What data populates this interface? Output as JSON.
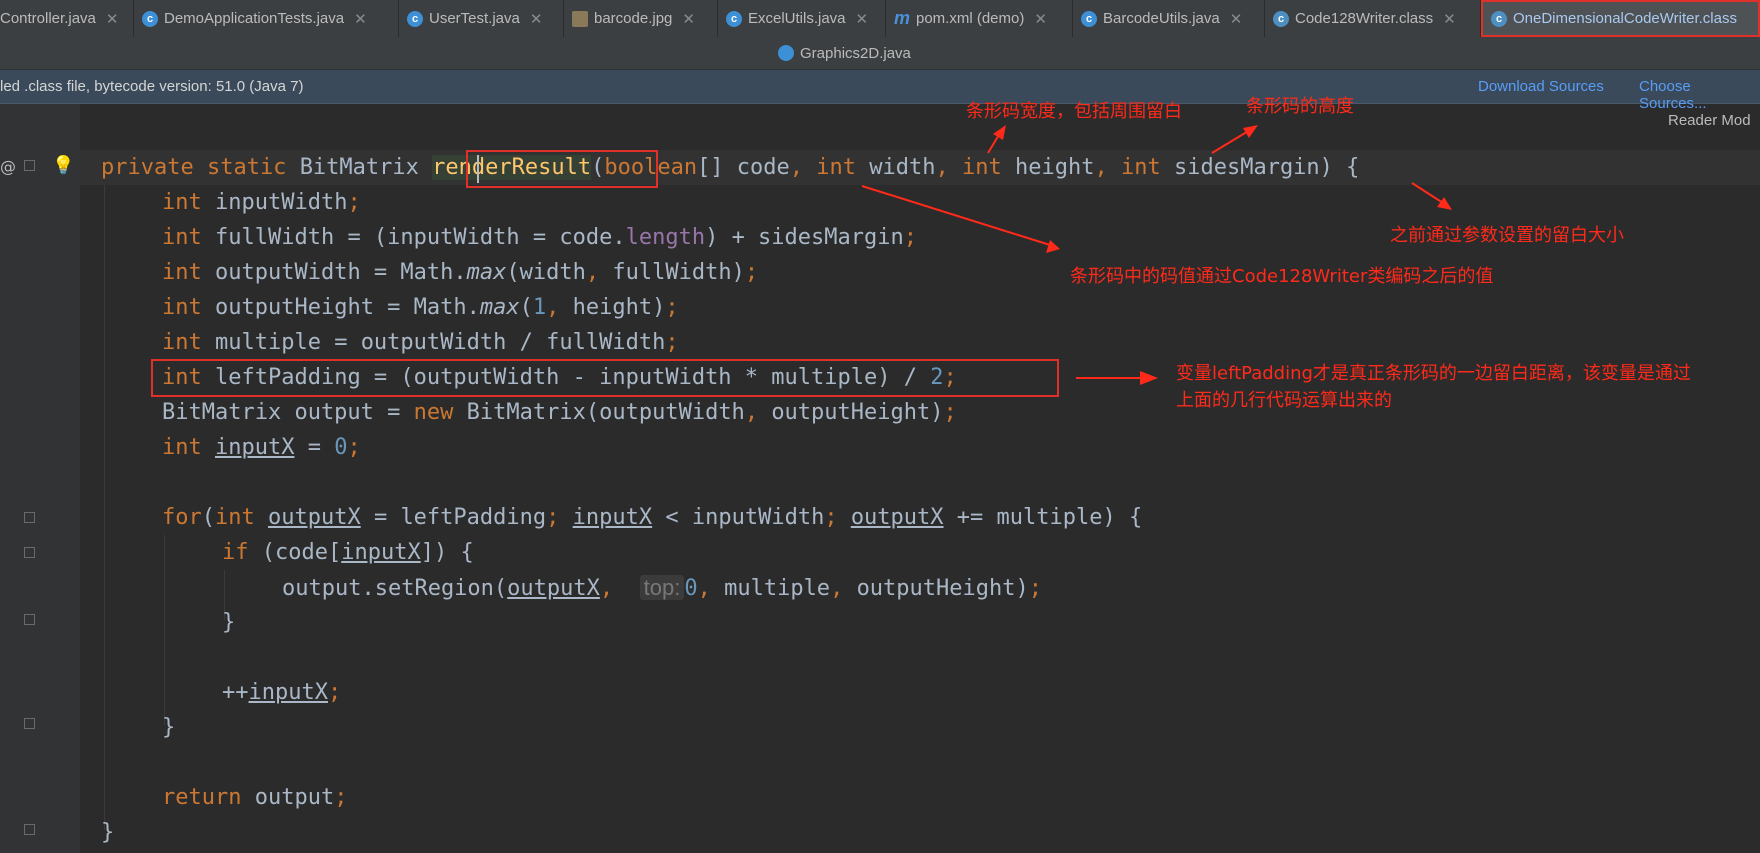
{
  "tabs": [
    {
      "label": "Controller.java",
      "icon": "class-icon"
    },
    {
      "label": "DemoApplicationTests.java",
      "icon": "class-icon"
    },
    {
      "label": "UserTest.java",
      "icon": "class-icon"
    },
    {
      "label": "barcode.jpg",
      "icon": "image-file-icon"
    },
    {
      "label": "ExcelUtils.java",
      "icon": "class-icon"
    },
    {
      "label": "pom.xml (demo)",
      "icon": "maven-icon"
    },
    {
      "label": "BarcodeUtils.java",
      "icon": "class-icon"
    },
    {
      "label": "Code128Writer.class",
      "icon": "compiled-class-icon"
    },
    {
      "label": "OneDimensionalCodeWriter.class",
      "icon": "compiled-class-icon"
    }
  ],
  "second_row_tab": "Graphics2D.java",
  "banner": {
    "text": "led .class file, bytecode version: 51.0 (Java 7)",
    "download_sources": "Download Sources",
    "choose_sources": "Choose Sources..."
  },
  "reader_mode": "Reader Mod",
  "code": {
    "l1": {
      "mod": "private static ",
      "type": "BitMatrix ",
      "method": "renderResult",
      "p1": "(",
      "kw_boolean": "boolean",
      "p2": "[] code",
      "c1": ", ",
      "kw_int1": "int",
      "p3": " width",
      "c2": ", ",
      "kw_int2": "int",
      "p4": " height",
      "c3": ", ",
      "kw_int3": "int",
      "p5": " sidesMargin) {"
    },
    "l2": {
      "kw": "int",
      "rest": " inputWidth",
      "semi": ";"
    },
    "l3": {
      "kw": "int",
      "a": " fullWidth = (inputWidth = code.",
      "fld": "length",
      "b": ") + sidesMargin",
      "semi": ";"
    },
    "l4": {
      "kw": "int",
      "a": " outputWidth = Math.",
      "it": "max",
      "b": "(width",
      "c": ", ",
      "d": "fullWidth)",
      "semi": ";"
    },
    "l5": {
      "kw": "int",
      "a": " outputHeight = Math.",
      "it": "max",
      "b": "(",
      "num": "1",
      "c": ", ",
      "d": "height)",
      "semi": ";"
    },
    "l6": {
      "kw": "int",
      "a": " multiple = outputWidth / fullWidth",
      "semi": ";"
    },
    "l7": {
      "kw": "int",
      "a": " leftPadding = (outputWidth - inputWidth * multiple) / ",
      "num": "2",
      "semi": ";"
    },
    "l8": {
      "a": "BitMatrix output = ",
      "kw": "new ",
      "b": "BitMatrix(outputWidth",
      "c": ", ",
      "d": "outputHeight)",
      "semi": ";"
    },
    "l9": {
      "kw": "int ",
      "ul": "inputX",
      "a": " = ",
      "num": "0",
      "semi": ";"
    },
    "l10": {
      "kw": "for",
      "a": "(",
      "kw2": "int ",
      "ul1": "outputX",
      "b": " = leftPadding",
      "s1": "; ",
      "ul2": "inputX",
      "c": " < inputWidth",
      "s2": "; ",
      "ul3": "outputX",
      "d": " += multiple) {"
    },
    "l11": {
      "kw": "if ",
      "a": "(code[",
      "ul": "inputX",
      "b": "]) {"
    },
    "l12": {
      "a": "output.setRegion(",
      "ul": "outputX",
      "c1": ", ",
      "hint": "top:",
      "num": "0",
      "c2": ", ",
      "b": "multiple",
      "c3": ", ",
      "d": "outputHeight)",
      "semi": ";"
    },
    "l13": {
      "a": "}"
    },
    "l15": {
      "a": "++",
      "ul": "inputX",
      "semi": ";"
    },
    "l16": {
      "a": "}"
    },
    "l18": {
      "kw": "return ",
      "a": "output",
      "semi": ";"
    },
    "l19": {
      "a": "}"
    }
  },
  "annotations": {
    "width_note": "条形码宽度，包括周围留白",
    "height_note": "条形码的高度",
    "margin_note": "之前通过参数设置的留白大小",
    "code_note": "条形码中的码值通过Code128Writer类编码之后的值",
    "padding_note_line1": "变量leftPadding才是真正条形码的一边留白距离，该变量是通过",
    "padding_note_line2": "上面的几行代码运算出来的"
  },
  "colors": {
    "annotation": "#ff2a1a",
    "keyword": "#cc7832",
    "number": "#6897bb",
    "text": "#a9b7c6"
  }
}
